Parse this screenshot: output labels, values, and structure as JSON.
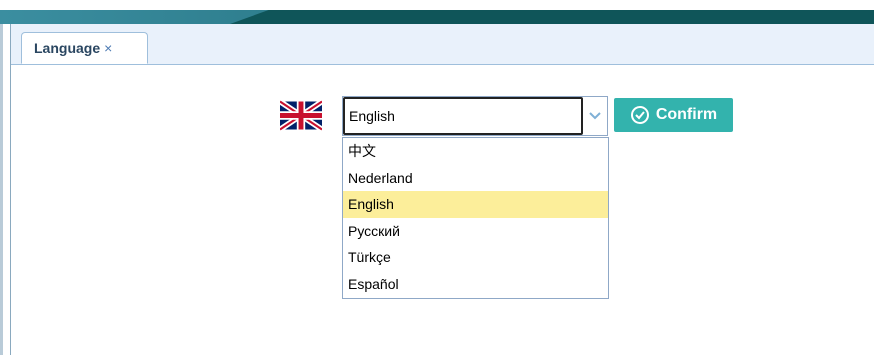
{
  "tab": {
    "label": "Language",
    "close": "×"
  },
  "language_select": {
    "value": "English"
  },
  "dropdown_options": [
    "中文",
    "Nederland",
    "English",
    "Русский",
    "Türkçe",
    "Español"
  ],
  "selected_option": "English",
  "confirm_button": {
    "label": "Confirm",
    "icon": "check-circle-icon"
  },
  "flag": {
    "icon": "uk-flag-icon"
  },
  "colors": {
    "accent": "#33b3ad",
    "header_dark": "#0f5559",
    "tab_bar": "#e9f1fb",
    "highlight": "#fcee9a"
  }
}
